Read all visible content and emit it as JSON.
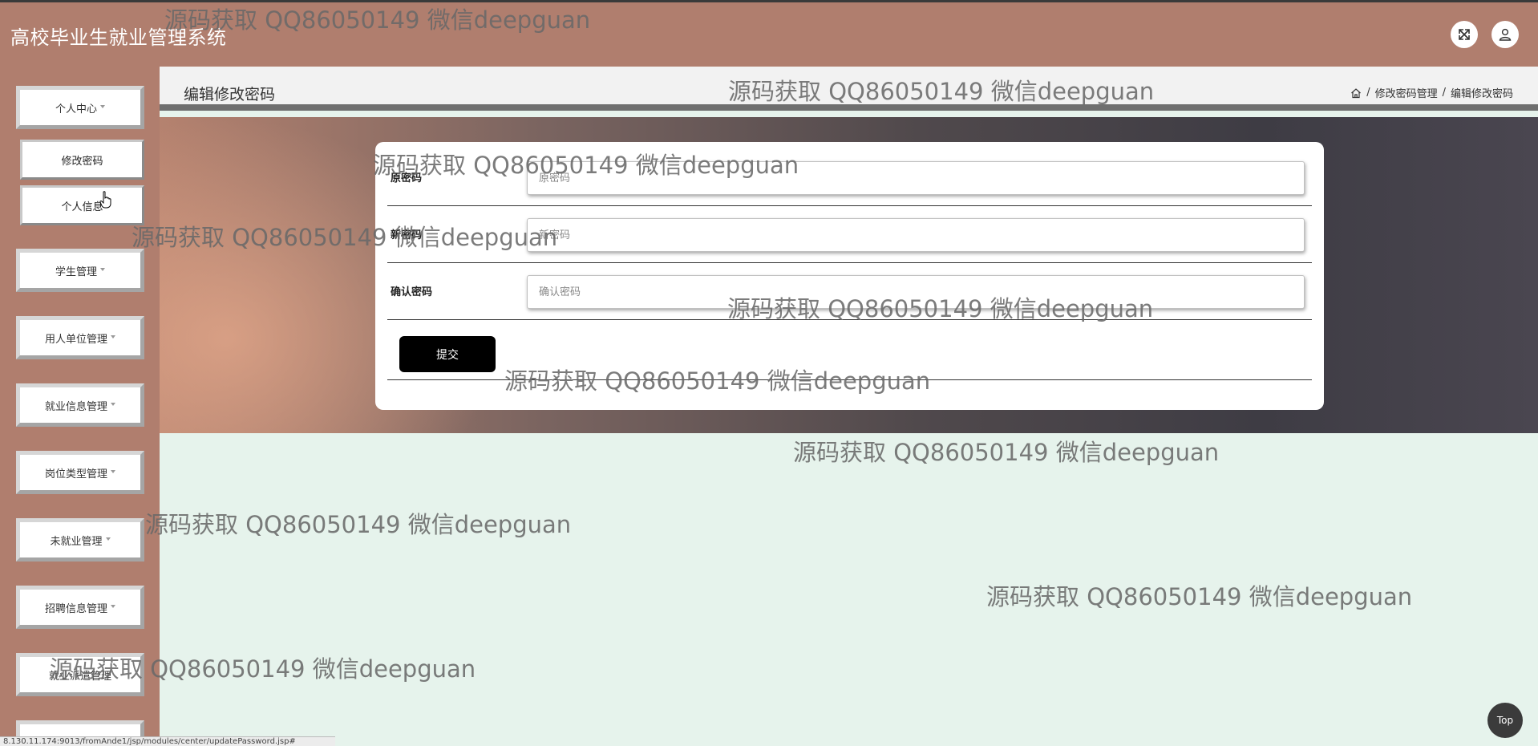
{
  "header": {
    "title": "高校毕业生就业管理系统",
    "fullscreen_icon": "expand-icon",
    "user_icon": "user-icon"
  },
  "sidebar": {
    "menus": [
      {
        "label": "个人中心",
        "expanded": true,
        "children": [
          "修改密码",
          "个人信息"
        ]
      },
      {
        "label": "学生管理"
      },
      {
        "label": "用人单位管理"
      },
      {
        "label": "就业信息管理"
      },
      {
        "label": "岗位类型管理"
      },
      {
        "label": "未就业管理"
      },
      {
        "label": "招聘信息管理"
      },
      {
        "label": "就业派遣管理"
      }
    ]
  },
  "main": {
    "page_title": "编辑修改密码",
    "breadcrumb": [
      "修改密码管理",
      "编辑修改密码"
    ],
    "form": {
      "fields": [
        {
          "label": "原密码",
          "placeholder": "原密码",
          "value": ""
        },
        {
          "label": "新密码",
          "placeholder": "新密码",
          "value": ""
        },
        {
          "label": "确认密码",
          "placeholder": "确认密码",
          "value": ""
        }
      ],
      "submit_label": "提交"
    }
  },
  "top_button_label": "Top",
  "status_url": "8.130.11.174:9013/fromAnde1/jsp/modules/center/updatePassword.jsp#",
  "watermark": "源码获取 QQ86050149 微信deepguan"
}
